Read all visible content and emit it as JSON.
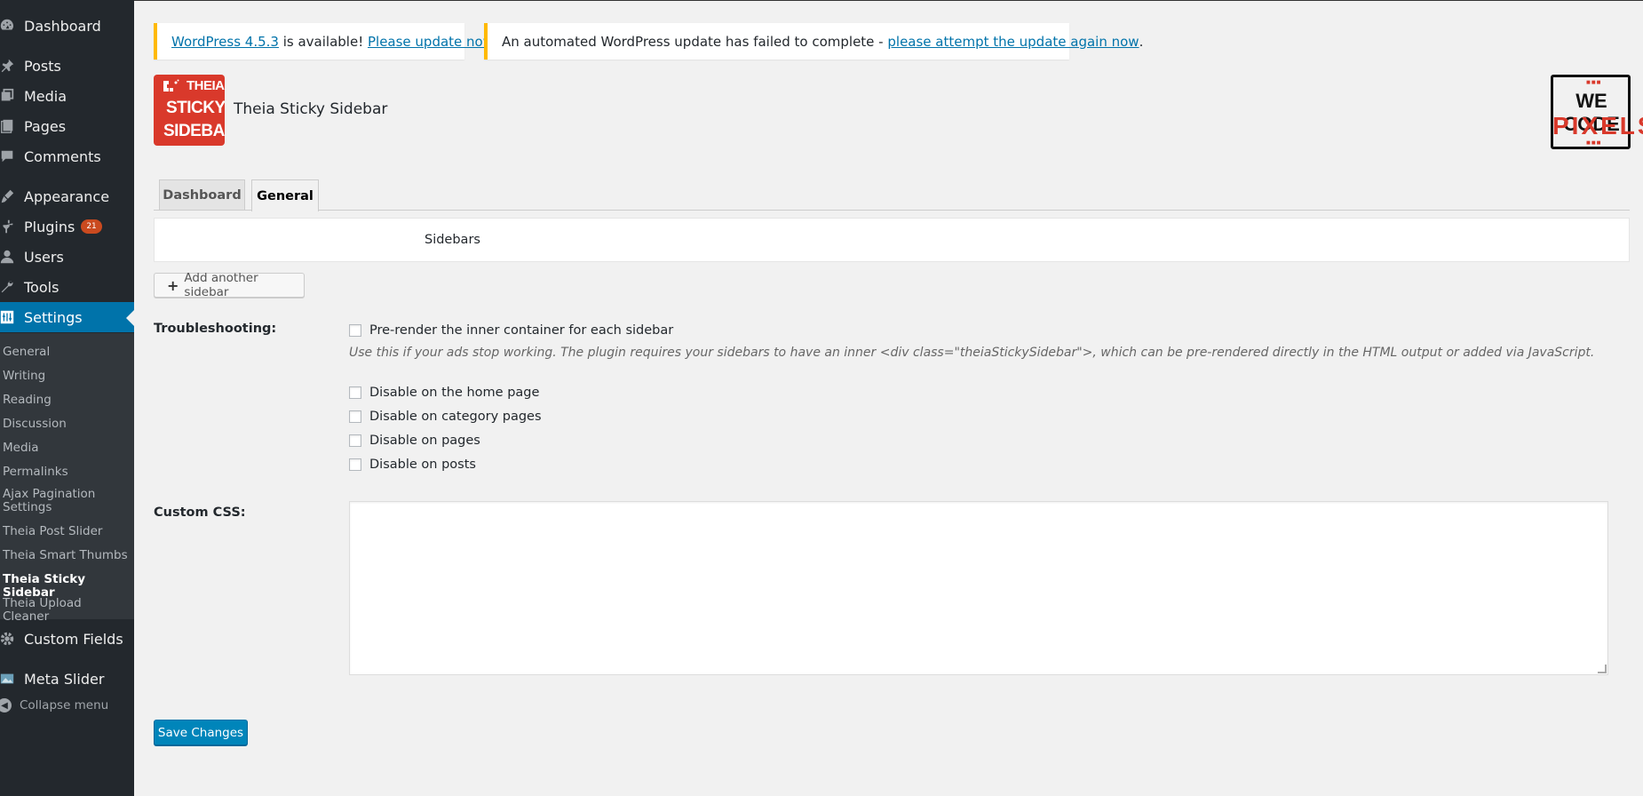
{
  "sidebar": {
    "items": [
      {
        "label": "Dashboard",
        "icon": "dashboard-icon"
      },
      {
        "label": "Posts",
        "icon": "pushpin-icon"
      },
      {
        "label": "Media",
        "icon": "media-icon"
      },
      {
        "label": "Pages",
        "icon": "pages-icon"
      },
      {
        "label": "Comments",
        "icon": "comment-icon"
      },
      {
        "label": "Appearance",
        "icon": "brush-icon"
      },
      {
        "label": "Plugins",
        "icon": "plugin-icon",
        "badge": "21"
      },
      {
        "label": "Users",
        "icon": "user-icon"
      },
      {
        "label": "Tools",
        "icon": "wrench-icon"
      },
      {
        "label": "Settings",
        "icon": "settings-icon"
      },
      {
        "label": "Custom Fields",
        "icon": "gear-icon"
      },
      {
        "label": "Meta Slider",
        "icon": "slider-icon"
      }
    ],
    "settings_submenu": [
      "General",
      "Writing",
      "Reading",
      "Discussion",
      "Media",
      "Permalinks",
      "Ajax Pagination Settings",
      "Theia Post Slider",
      "Theia Smart Thumbs",
      "Theia Sticky Sidebar",
      "Theia Upload Cleaner"
    ],
    "collapse_label": "Collapse menu"
  },
  "notices": {
    "update": {
      "link1": "WordPress 4.5.3",
      "text": " is available! ",
      "link2": "Please update now",
      "end": "."
    },
    "failed": {
      "text": "An automated WordPress update has failed to complete - ",
      "link": "please attempt the update again now",
      "end": "."
    }
  },
  "plugin": {
    "title": "Theia Sticky Sidebar",
    "logo_lines": [
      "THEIA",
      "STICKY",
      "SIDEBAR"
    ],
    "brand_logo_lines": [
      "WE CODE",
      "PIXELS"
    ]
  },
  "tabs": [
    "Dashboard",
    "General"
  ],
  "sidebars_label": "Sidebars",
  "add_sidebar_label": "Add another sidebar",
  "troubleshooting": {
    "label": "Troubleshooting:",
    "prerender_label": "Pre-render the inner container for each sidebar",
    "description": "Use this if your ads stop working. The plugin requires your sidebars to have an inner <div class=\"theiaStickySidebar\">, which can be pre-rendered directly in the HTML output or added via JavaScript.",
    "options": [
      "Disable on the home page",
      "Disable on category pages",
      "Disable on pages",
      "Disable on posts"
    ]
  },
  "custom_css": {
    "label": "Custom CSS:",
    "value": ""
  },
  "save_label": "Save Changes",
  "colors": {
    "accent": "#0073aa",
    "menu_bg": "#23282d",
    "brand_red": "#d9392b",
    "notice_warning": "#ffb900"
  }
}
